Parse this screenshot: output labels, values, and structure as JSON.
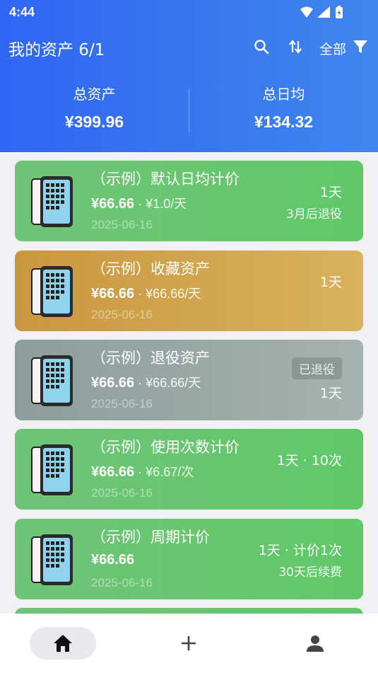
{
  "status_bar": {
    "time": "4:44",
    "icons": [
      "wifi-icon",
      "cellular-signal-icon",
      "battery-charging-icon"
    ]
  },
  "app_bar": {
    "title": "我的资产 6/1",
    "filter_label": "全部",
    "actions": [
      "search-icon",
      "sort-icon",
      "filter-icon"
    ]
  },
  "summary": {
    "total_assets_label": "总资产",
    "total_assets_value": "¥399.96",
    "daily_avg_label": "总日均",
    "daily_avg_value": "¥134.32"
  },
  "colors": {
    "header_gradient": [
      "#2f66f3",
      "#3f86ec"
    ],
    "card_green": "#66c56e",
    "card_gold": "#d2a650",
    "card_gray": "#9aa8a4"
  },
  "assets": [
    {
      "name": "（示例）默认日均计价",
      "price": "¥66.66",
      "avg": " · ¥1.0/天",
      "date": "2025-06-16",
      "right_line1": "1天",
      "right_line2": "3月后退役",
      "style": "green"
    },
    {
      "name": "（示例）收藏资产",
      "price": "¥66.66",
      "avg": " · ¥66.66/天",
      "date": "2025-06-16",
      "right_line1": "1天",
      "right_line2": "",
      "style": "gold"
    },
    {
      "name": "（示例）退役资产",
      "price": "¥66.66",
      "avg": " · ¥66.66/天",
      "date": "2025-06-16",
      "badge": "已退役",
      "right_line1": "1天",
      "style": "gray"
    },
    {
      "name": "（示例）使用次数计价",
      "price": "¥66.66",
      "avg": " · ¥6.67/次",
      "date": "2025-06-16",
      "right_line1": "1天 · 10次",
      "right_line2": "",
      "style": "green"
    },
    {
      "name": "（示例）周期计价",
      "price": "¥66.66",
      "avg": "",
      "date": "2025-06-16",
      "right_line1": "1天 · 计价1次",
      "right_line2": "30天后续费",
      "style": "green"
    }
  ],
  "bottom_nav": {
    "tabs": [
      {
        "icon": "home-icon",
        "active": true
      },
      {
        "icon": "add-icon",
        "active": false
      },
      {
        "icon": "person-icon",
        "active": false
      }
    ]
  }
}
